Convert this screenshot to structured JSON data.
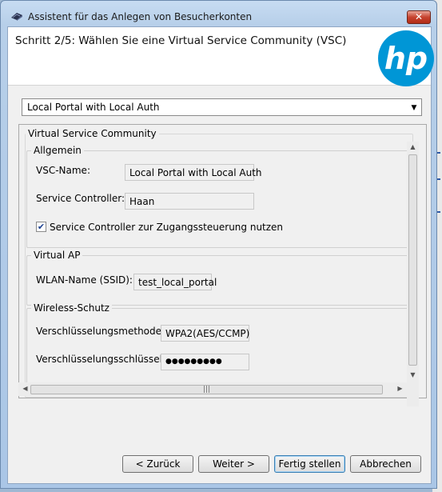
{
  "window": {
    "title": "Assistent für das Anlegen von Besucherkonten",
    "close_label": "✕"
  },
  "header": {
    "step_title": "Schritt 2/5: Wählen Sie eine Virtual Service Community (VSC)",
    "logo_text": "hp",
    "logo_color": "#0096d6"
  },
  "vsc_select": {
    "selected": "Local Portal with Local Auth"
  },
  "panel": {
    "title": "Virtual Service Community",
    "general": {
      "title": "Allgemein",
      "vsc_name_label": "VSC-Name:",
      "vsc_name_value": "Local Portal with Local Auth",
      "controller_label": "Service Controller:",
      "controller_value": "Haan",
      "access_control_label": "Service Controller zur Zugangssteuerung nutzen",
      "access_control_checked": true
    },
    "virtual_ap": {
      "title": "Virtual AP",
      "ssid_label": "WLAN-Name (SSID):",
      "ssid_value": "test_local_portal"
    },
    "wireless_security": {
      "title": "Wireless-Schutz",
      "method_label": "Verschlüsselungsmethode:",
      "method_value": "WPA2(AES/CCMP)",
      "key_label": "Verschlüsselungsschlüssel:",
      "key_value": "●●●●●●●●●"
    }
  },
  "buttons": {
    "back": "< Zurück",
    "next": "Weiter >",
    "finish": "Fertig stellen",
    "cancel": "Abbrechen"
  }
}
